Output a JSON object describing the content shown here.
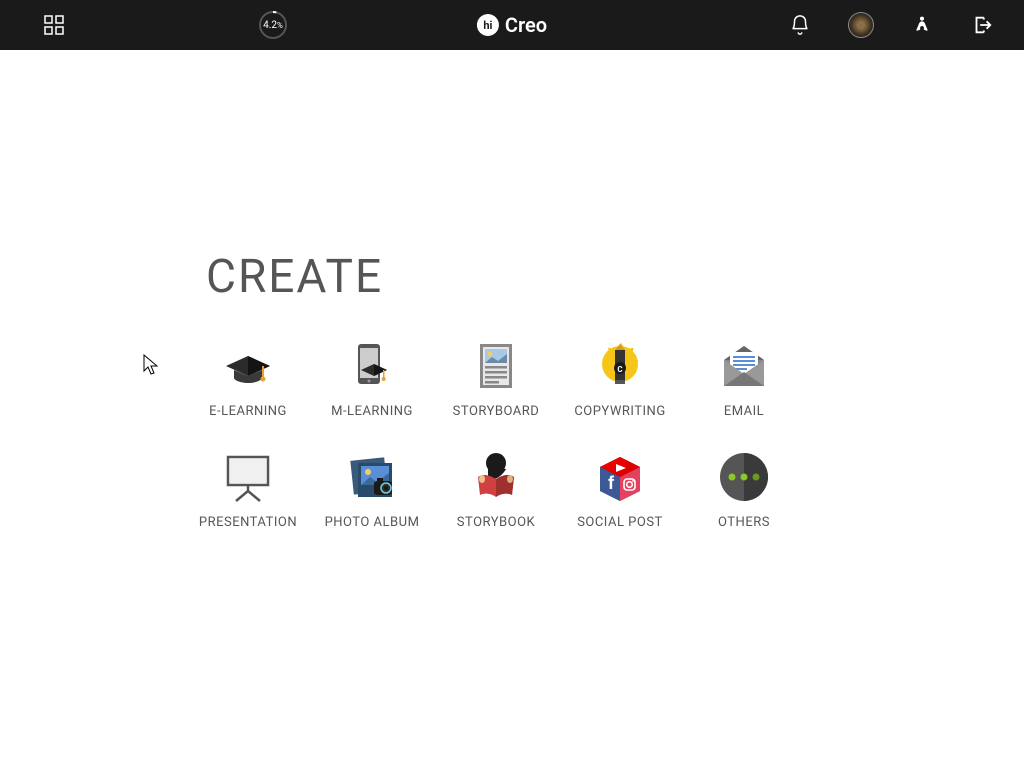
{
  "header": {
    "progress_text": "4.2",
    "progress_unit": "%",
    "logo_badge": "hi",
    "logo_text": "Creo"
  },
  "page": {
    "title": "CREATE"
  },
  "tiles": [
    {
      "id": "elearning",
      "label": "E-LEARNING"
    },
    {
      "id": "mlearning",
      "label": "M-LEARNING"
    },
    {
      "id": "storyboard",
      "label": "STORYBOARD"
    },
    {
      "id": "copywriting",
      "label": "COPYWRITING"
    },
    {
      "id": "email",
      "label": "EMAIL"
    },
    {
      "id": "presentation",
      "label": "PRESENTATION"
    },
    {
      "id": "photoalbum",
      "label": "PHOTO ALBUM"
    },
    {
      "id": "storybook",
      "label": "STORYBOOK"
    },
    {
      "id": "socialpost",
      "label": "SOCIAL POST"
    },
    {
      "id": "others",
      "label": "OTHERS"
    }
  ]
}
